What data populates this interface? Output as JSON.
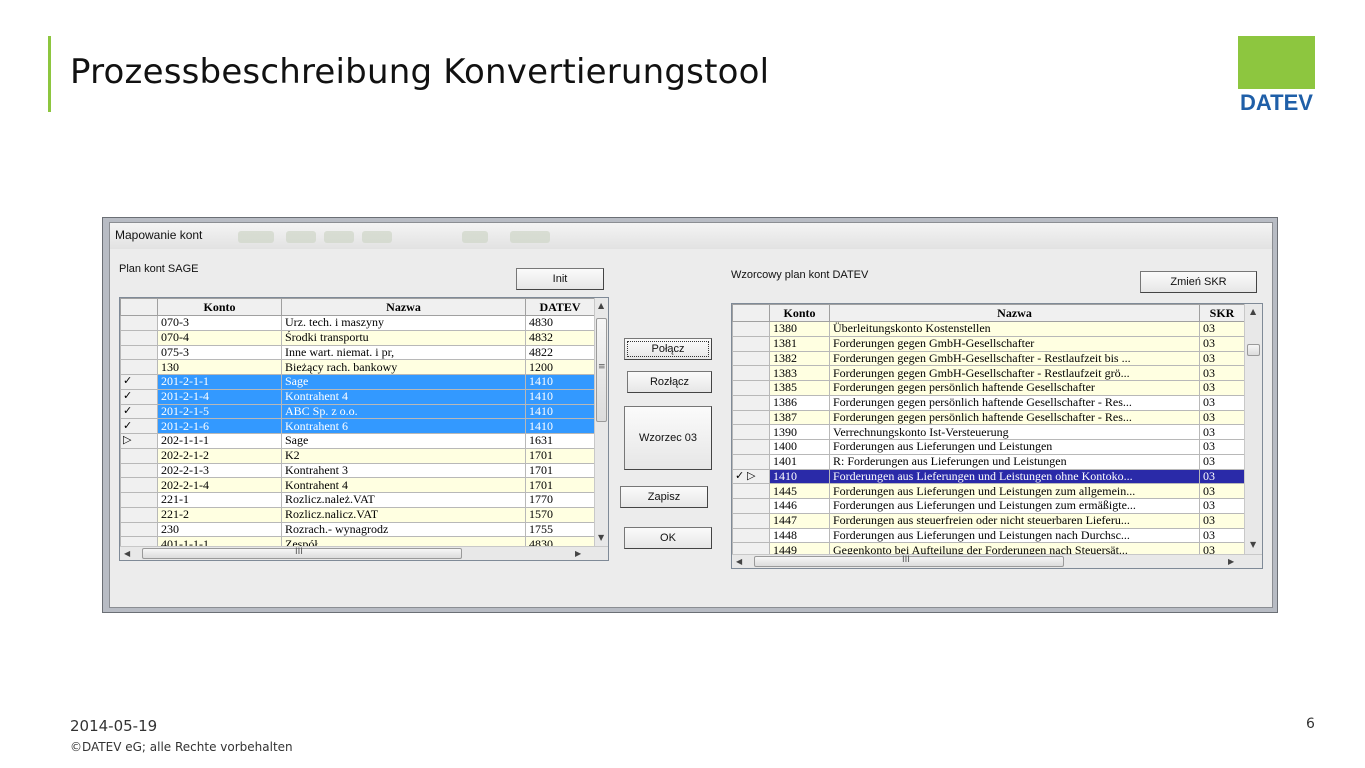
{
  "slide": {
    "title": "Prozessbeschreibung  Konvertierungstool",
    "logo_text": "DATEV",
    "date": "2014-05-19",
    "copyright": "©DATEV eG; alle Rechte vorbehalten",
    "page_number": "6"
  },
  "colors": {
    "accent_green": "#8dc63f",
    "logo_blue": "#1f5fa8",
    "selection_blue": "#3399ff",
    "current_row": "#2a2aa8",
    "row_yellow": "#ffffe1"
  },
  "window": {
    "title": "Mapowanie kont",
    "left_label": "Plan kont SAGE",
    "right_label": "Wzorcowy plan kont DATEV",
    "buttons": {
      "init": "Init",
      "polacz": "Połącz",
      "rozlacz": "Rozłącz",
      "wzorzec": "Wzorzec 03",
      "zapisz": "Zapisz",
      "ok": "OK",
      "zmien_skr": "Zmień SKR"
    },
    "left_grid": {
      "columns": [
        "Konto",
        "Nazwa",
        "DATEV"
      ],
      "rows": [
        {
          "ind": "",
          "konto": "070-3",
          "nazwa": "Urz. tech. i maszyny",
          "datev": "4830",
          "state": "white"
        },
        {
          "ind": "",
          "konto": "070-4",
          "nazwa": "Środki transportu",
          "datev": "4832",
          "state": "yellow"
        },
        {
          "ind": "",
          "konto": "075-3",
          "nazwa": "Inne wart. niemat. i pr,",
          "datev": "4822",
          "state": "white"
        },
        {
          "ind": "",
          "konto": "130",
          "nazwa": "Bieżący rach. bankowy",
          "datev": "1200",
          "state": "yellow"
        },
        {
          "ind": "✓",
          "konto": "201-2-1-1",
          "nazwa": "Sage",
          "datev": "1410",
          "state": "selected"
        },
        {
          "ind": "✓",
          "konto": "201-2-1-4",
          "nazwa": "Kontrahent 4",
          "datev": "1410",
          "state": "selected"
        },
        {
          "ind": "✓",
          "konto": "201-2-1-5",
          "nazwa": "ABC Sp. z o.o.",
          "datev": "1410",
          "state": "selected"
        },
        {
          "ind": "✓",
          "konto": "201-2-1-6",
          "nazwa": "Kontrahent 6",
          "datev": "1410",
          "state": "selected"
        },
        {
          "ind": "▷",
          "konto": "202-1-1-1",
          "nazwa": "Sage",
          "datev": "1631",
          "state": "white"
        },
        {
          "ind": "",
          "konto": "202-2-1-2",
          "nazwa": "K2",
          "datev": "1701",
          "state": "yellow"
        },
        {
          "ind": "",
          "konto": "202-2-1-3",
          "nazwa": "Kontrahent 3",
          "datev": "1701",
          "state": "white"
        },
        {
          "ind": "",
          "konto": "202-2-1-4",
          "nazwa": "Kontrahent 4",
          "datev": "1701",
          "state": "yellow"
        },
        {
          "ind": "",
          "konto": "221-1",
          "nazwa": "Rozlicz.należ.VAT",
          "datev": "1770",
          "state": "white"
        },
        {
          "ind": "",
          "konto": "221-2",
          "nazwa": "Rozlicz.nalicz.VAT",
          "datev": "1570",
          "state": "yellow"
        },
        {
          "ind": "",
          "konto": "230",
          "nazwa": "Rozrach.- wynagrodz",
          "datev": "1755",
          "state": "white"
        },
        {
          "ind": "",
          "konto": "401-1-1-1",
          "nazwa": "Zespół",
          "datev": "4830",
          "state": "yellow"
        }
      ]
    },
    "right_grid": {
      "columns": [
        "Konto",
        "Nazwa",
        "SKR"
      ],
      "rows": [
        {
          "ind": "",
          "konto": "1380",
          "nazwa": "Überleitungskonto Kostenstellen",
          "skr": "03",
          "state": "yellow"
        },
        {
          "ind": "",
          "konto": "1381",
          "nazwa": "Forderungen gegen GmbH-Gesellschafter",
          "skr": "03",
          "state": "yellow"
        },
        {
          "ind": "",
          "konto": "1382",
          "nazwa": "Forderungen gegen GmbH-Gesellschafter - Restlaufzeit bis ...",
          "skr": "03",
          "state": "yellow"
        },
        {
          "ind": "",
          "konto": "1383",
          "nazwa": "Forderungen gegen GmbH-Gesellschafter - Restlaufzeit grö...",
          "skr": "03",
          "state": "yellow"
        },
        {
          "ind": "",
          "konto": "1385",
          "nazwa": "Forderungen gegen persönlich haftende Gesellschafter",
          "skr": "03",
          "state": "yellow"
        },
        {
          "ind": "",
          "konto": "1386",
          "nazwa": "Forderungen gegen persönlich haftende Gesellschafter - Res...",
          "skr": "03",
          "state": "white"
        },
        {
          "ind": "",
          "konto": "1387",
          "nazwa": "Forderungen gegen persönlich haftende Gesellschafter - Res...",
          "skr": "03",
          "state": "yellow"
        },
        {
          "ind": "",
          "konto": "1390",
          "nazwa": "Verrechnungskonto Ist-Versteuerung",
          "skr": "03",
          "state": "white"
        },
        {
          "ind": "",
          "konto": "1400",
          "nazwa": "Forderungen aus Lieferungen und Leistungen",
          "skr": "03",
          "state": "white"
        },
        {
          "ind": "",
          "konto": "1401",
          "nazwa": "R: Forderungen aus Lieferungen und Leistungen",
          "skr": "03",
          "state": "white"
        },
        {
          "ind": "✓ ▷",
          "konto": "1410",
          "nazwa": "Forderungen aus Lieferungen und Leistungen ohne Kontoko...",
          "skr": "03",
          "state": "current"
        },
        {
          "ind": "",
          "konto": "1445",
          "nazwa": "Forderungen aus Lieferungen und Leistungen zum allgemein...",
          "skr": "03",
          "state": "yellow"
        },
        {
          "ind": "",
          "konto": "1446",
          "nazwa": "Forderungen aus Lieferungen und Leistungen zum ermäßigte...",
          "skr": "03",
          "state": "white"
        },
        {
          "ind": "",
          "konto": "1447",
          "nazwa": "Forderungen aus steuerfreien oder nicht steuerbaren Lieferu...",
          "skr": "03",
          "state": "yellow"
        },
        {
          "ind": "",
          "konto": "1448",
          "nazwa": "Forderungen aus Lieferungen und Leistungen nach Durchsc...",
          "skr": "03",
          "state": "white"
        },
        {
          "ind": "",
          "konto": "1449",
          "nazwa": "Gegenkonto bei Aufteilung der Forderungen nach Steuersät...",
          "skr": "03",
          "state": "yellow"
        }
      ]
    }
  }
}
